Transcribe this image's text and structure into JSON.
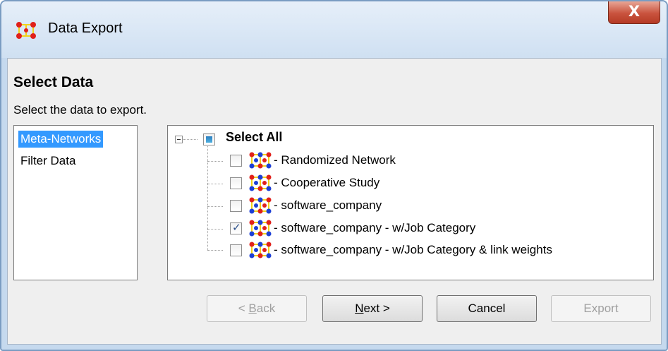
{
  "window": {
    "title": "Data Export",
    "close_glyph": "X",
    "app_icon": "network-icon"
  },
  "page": {
    "heading": "Select Data",
    "description": "Select the data to export."
  },
  "left_panel": {
    "items": [
      {
        "label": "Meta-Networks",
        "selected": true
      },
      {
        "label": "Filter Data",
        "selected": false
      }
    ]
  },
  "tree": {
    "root": {
      "label": "Select All",
      "state": "partial"
    },
    "items": [
      {
        "label": "- Randomized Network",
        "checked": false
      },
      {
        "label": "- Cooperative Study",
        "checked": false
      },
      {
        "label": "- software_company",
        "checked": false
      },
      {
        "label": "- software_company - w/Job Category",
        "checked": true
      },
      {
        "label": "- software_company - w/Job Category & link weights",
        "checked": false
      }
    ]
  },
  "buttons": {
    "back": {
      "prefix": "< ",
      "mnemonic": "B",
      "rest": "ack",
      "enabled": false
    },
    "next": {
      "prefix": "",
      "mnemonic": "N",
      "rest": "ext >",
      "enabled": true
    },
    "cancel": {
      "label": "Cancel",
      "enabled": true
    },
    "export": {
      "label": "Export",
      "enabled": false
    }
  },
  "colors": {
    "selection": "#3399ff",
    "node_red": "#e0201b",
    "node_yellow": "#f2d21c",
    "node_blue": "#1c3fd6"
  }
}
